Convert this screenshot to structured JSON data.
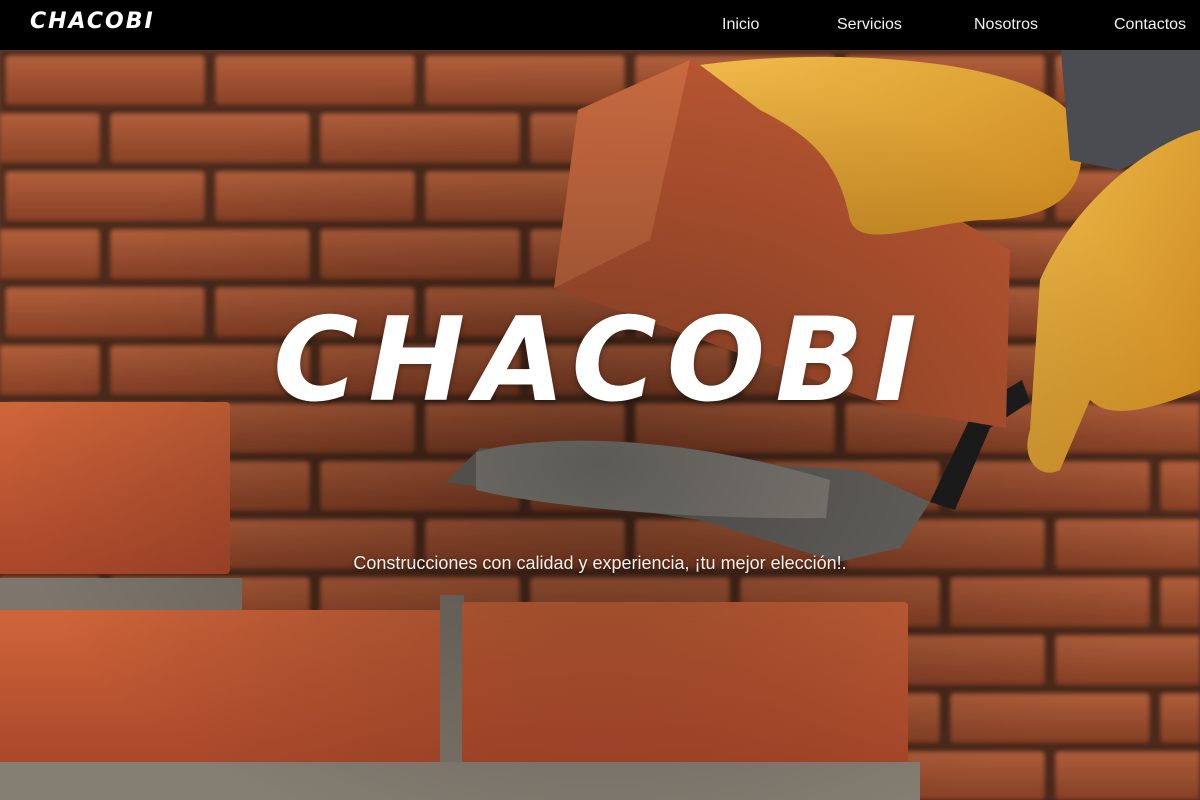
{
  "navbar": {
    "brand": "CHACOBI",
    "links": [
      {
        "label": "Inicio"
      },
      {
        "label": "Servicios"
      },
      {
        "label": "Nosotros"
      },
      {
        "label": "Contactos"
      }
    ]
  },
  "hero": {
    "title": "CHACOBI",
    "tagline": "Construcciones con calidad y experiencia, ¡tu mejor elección!.",
    "image": "bricklayer-hero-image"
  },
  "colors": {
    "navbar_bg": "#000000",
    "brick": "#b0512f",
    "mortar": "#8a8378",
    "glove": "#e0a030",
    "text": "#ffffff"
  }
}
